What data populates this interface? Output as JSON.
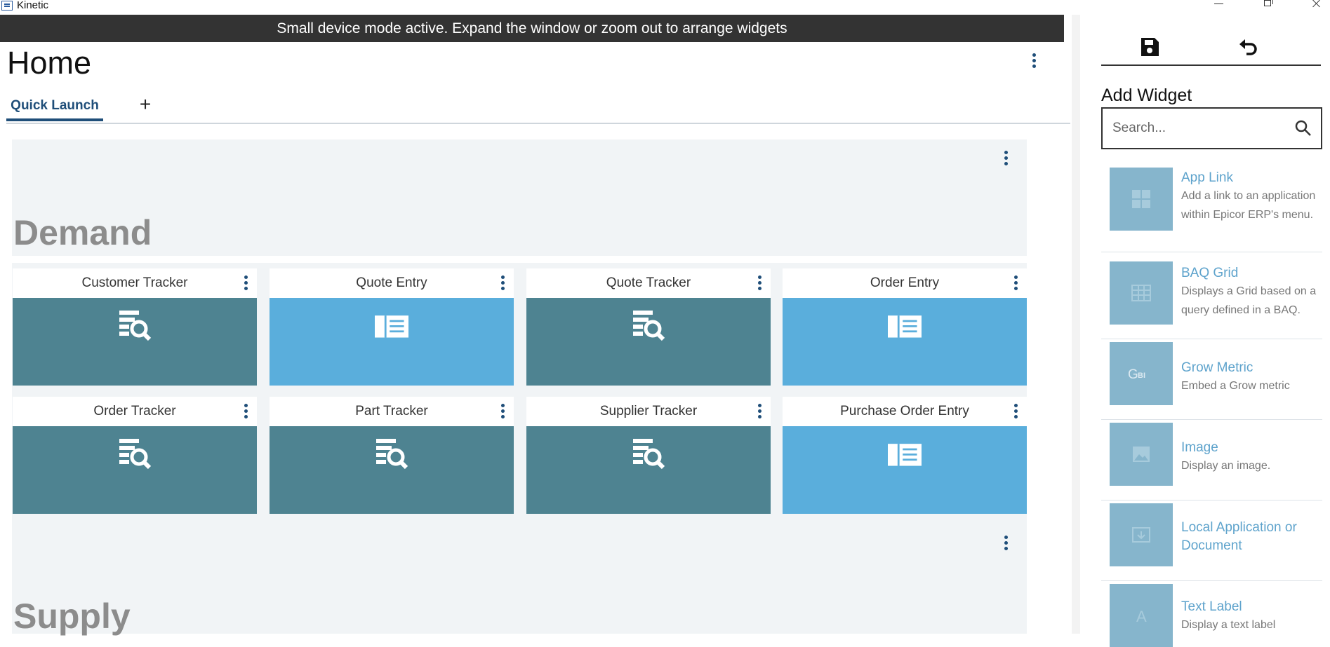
{
  "window": {
    "title": "Kinetic"
  },
  "banner": {
    "text": "Small device mode active. Expand the window or zoom out to arrange widgets"
  },
  "page": {
    "title": "Home"
  },
  "tabs": [
    {
      "label": "Quick Launch"
    }
  ],
  "add_tab_label": "+",
  "sections": [
    {
      "title": "Demand"
    },
    {
      "title": "Supply"
    }
  ],
  "tiles": [
    {
      "label": "Customer Tracker",
      "type": "tracker"
    },
    {
      "label": "Quote Entry",
      "type": "entry"
    },
    {
      "label": "Quote Tracker",
      "type": "tracker"
    },
    {
      "label": "Order Entry",
      "type": "entry"
    },
    {
      "label": "Order Tracker",
      "type": "tracker"
    },
    {
      "label": "Part Tracker",
      "type": "tracker"
    },
    {
      "label": "Supplier Tracker",
      "type": "tracker"
    },
    {
      "label": "Purchase Order Entry",
      "type": "entry"
    }
  ],
  "side_panel": {
    "heading": "Add Widget",
    "search_placeholder": "Search...",
    "widgets": [
      {
        "name": "App Link",
        "description": "Add a link to an application within Epicor ERP's menu.",
        "icon": "apps-icon"
      },
      {
        "name": "BAQ Grid",
        "description": "Displays a Grid based on a query defined in a BAQ.",
        "icon": "grid-icon"
      },
      {
        "name": "Grow Metric",
        "description": "Embed a Grow metric",
        "icon": "grow-bi-icon",
        "icon_text": "GBI"
      },
      {
        "name": "Image",
        "description": "Display an image.",
        "icon": "image-icon"
      },
      {
        "name": "Local Application or Document",
        "description": "",
        "icon": "local-app-icon"
      },
      {
        "name": "Text Label",
        "description": "Display a text label",
        "icon": "text-icon",
        "icon_text": "A"
      }
    ]
  },
  "colors": {
    "tracker": "#4e8391",
    "entry": "#5aaedc",
    "accent": "#1f4e79",
    "widget_link": "#5ea3cc"
  }
}
